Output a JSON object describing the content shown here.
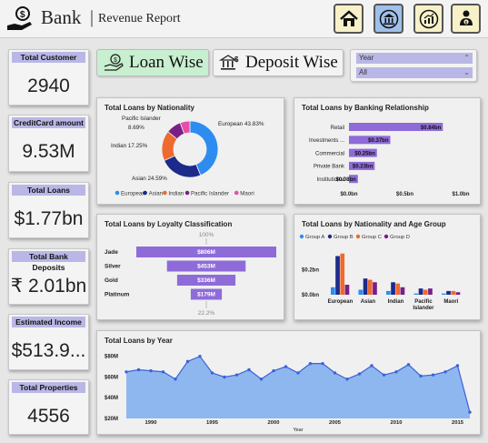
{
  "header": {
    "brand": "Bank",
    "separator": "|",
    "subtitle": "Revenue Report"
  },
  "nav_icons": [
    "home-icon",
    "bank-icon",
    "chart-icon",
    "person-money-icon"
  ],
  "kpis": [
    {
      "label": "Total Customer",
      "value": "2940"
    },
    {
      "label": "CreditCard amount",
      "value": "9.53M"
    },
    {
      "label": "Total Loans",
      "value": "$1.77bn"
    },
    {
      "label": "Total Bank Deposits",
      "value": "₹ 2.01bn"
    },
    {
      "label": "Estimated Income",
      "value": "$513.9..."
    },
    {
      "label": "Total Properties",
      "value": "4556"
    }
  ],
  "toggles": {
    "loan": "Loan Wise",
    "deposit": "Deposit Wise"
  },
  "filters": {
    "year_label": "Year",
    "year_value": "All"
  },
  "colors": {
    "accent": "#8e6bd8",
    "header_chip": "#b9b7e6",
    "toggle_active": "#c8efd0",
    "area_fill": "#8fb7ef",
    "line": "#3a63d8"
  },
  "chart_data": [
    {
      "type": "pie",
      "title": "Total Loans by Nationality",
      "labels": [
        "European",
        "Asian",
        "Indian",
        "Pacific Islander",
        "Maori"
      ],
      "values": [
        43.83,
        24.59,
        17.25,
        8.69,
        5.64
      ],
      "slice_labels": [
        "European 43.83%",
        "Asian 24.59%",
        "Indian 17.25%",
        "Pacific Islander",
        "8.69%"
      ],
      "colors": [
        "#2e8cf0",
        "#1c2a8c",
        "#ee6a2e",
        "#7a1f86",
        "#e64fa6"
      ],
      "legend": "bottom"
    },
    {
      "type": "bar",
      "title": "Total Loans by Banking Relationship",
      "categories": [
        "Retail",
        "Investments ...",
        "Commercial",
        "Private Bank",
        "Institutional"
      ],
      "values": [
        0.84,
        0.37,
        0.25,
        0.23,
        0.08
      ],
      "data_labels": [
        "$0.84bn",
        "$0.37bn",
        "$0.25bn",
        "$0.23bn",
        "$0.08bn"
      ],
      "x_ticks": [
        "$0.0bn",
        "$0.5bn",
        "$1.0bn"
      ],
      "xlim": [
        0,
        1.0
      ]
    },
    {
      "type": "bar",
      "title": "Total Loans by Loyalty Classification",
      "categories": [
        "Jade",
        "Silver",
        "Gold",
        "Platinum"
      ],
      "values": [
        806,
        453,
        336,
        179
      ],
      "data_labels": [
        "$806M",
        "$453M",
        "$336M",
        "$179M"
      ],
      "top_label": "100%",
      "bottom_label": "22.2%"
    },
    {
      "type": "bar",
      "title": "Total Loans by Nationality and Age Group",
      "categories": [
        "European",
        "Asian",
        "Indian",
        "Pacific Islander",
        "Maori"
      ],
      "series": [
        {
          "name": "Group A",
          "values": [
            0.06,
            0.04,
            0.03,
            0.01,
            0.01
          ]
        },
        {
          "name": "Group B",
          "values": [
            0.31,
            0.13,
            0.1,
            0.05,
            0.03
          ]
        },
        {
          "name": "Group C",
          "values": [
            0.33,
            0.12,
            0.09,
            0.04,
            0.03
          ]
        },
        {
          "name": "Group D",
          "values": [
            0.08,
            0.1,
            0.06,
            0.05,
            0.02
          ]
        }
      ],
      "series_colors": [
        "#2e8cf0",
        "#1c2a8c",
        "#ee6a2e",
        "#7a1f86"
      ],
      "y_ticks": [
        "$0.2bn",
        "$0.0bn"
      ],
      "ylim": [
        0,
        0.35
      ],
      "legend": "top-left"
    },
    {
      "type": "area",
      "title": "Total Loans by Year",
      "xlabel": "Year",
      "x": [
        1988,
        1989,
        1990,
        1991,
        1992,
        1993,
        1994,
        1995,
        1996,
        1997,
        1998,
        1999,
        2000,
        2001,
        2002,
        2003,
        2004,
        2005,
        2006,
        2007,
        2008,
        2009,
        2010,
        2011,
        2012,
        2013,
        2014,
        2015,
        2016
      ],
      "values": [
        65,
        67,
        66,
        65,
        58,
        75,
        80,
        64,
        60,
        62,
        67,
        58,
        66,
        70,
        64,
        73,
        73,
        64,
        58,
        63,
        71,
        62,
        65,
        72,
        61,
        62,
        65,
        71,
        26
      ],
      "x_ticks": [
        "1990",
        "1995",
        "2000",
        "2005",
        "2010",
        "2015"
      ],
      "y_ticks": [
        "$80M",
        "$60M",
        "$40M",
        "$20M"
      ],
      "ylim": [
        20,
        85
      ]
    }
  ]
}
